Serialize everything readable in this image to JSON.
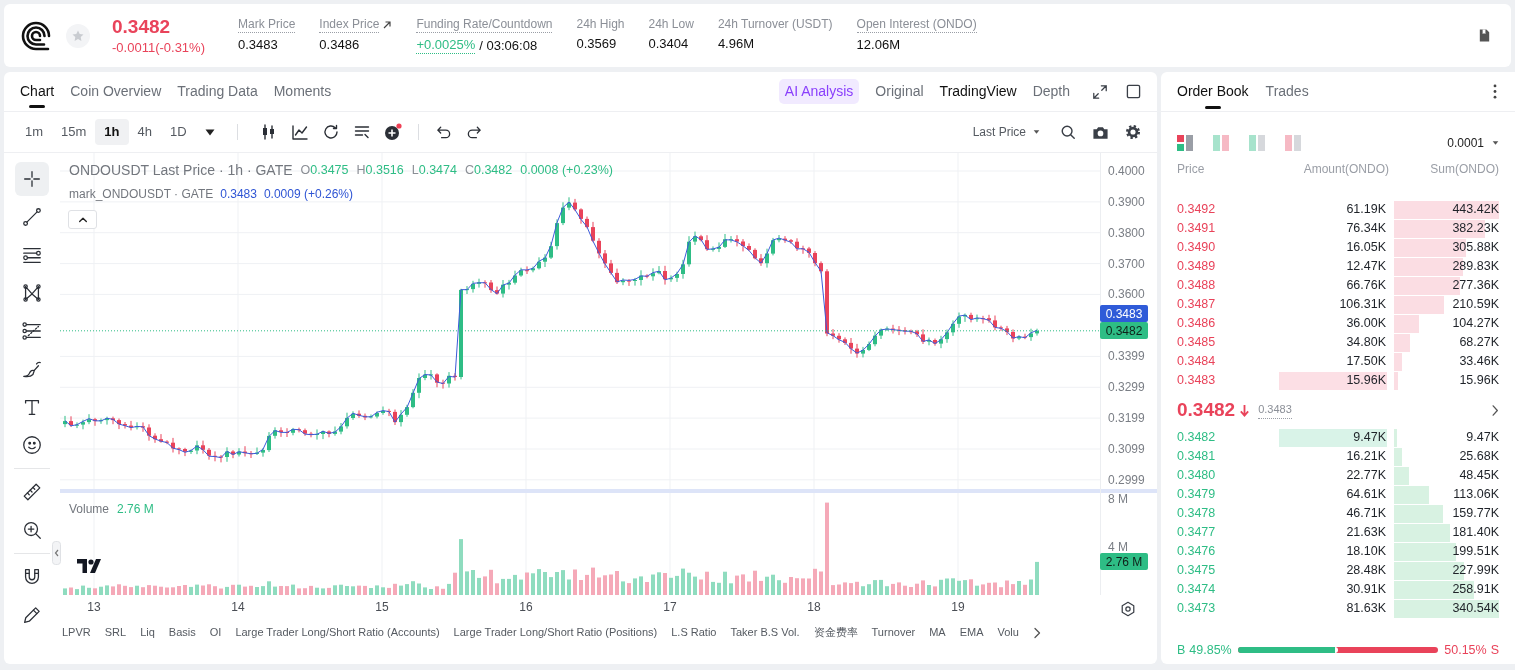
{
  "header": {
    "favorited": false,
    "price": "0.3482",
    "change": "-0.0011(-0.31%)",
    "falling": true,
    "stats": [
      {
        "kind": "plain",
        "label": "Mark Price",
        "value": "0.3483",
        "underlined": true
      },
      {
        "kind": "link",
        "label": "Index Price",
        "value": "0.3486",
        "underlined": true
      },
      {
        "kind": "funding",
        "label": "Funding Rate/Countdown",
        "value": "+0.0025%",
        "countdown": "/ 03:06:08",
        "underlined": true
      },
      {
        "kind": "plain",
        "label": "24h High",
        "value": "0.3569",
        "underlined": false
      },
      {
        "kind": "plain",
        "label": "24h Low",
        "value": "0.3404",
        "underlined": false
      },
      {
        "kind": "plain",
        "label": "24h Turnover (USDT)",
        "value": "4.96M",
        "underlined": false
      },
      {
        "kind": "plain",
        "label": "Open Interest (ONDO)",
        "value": "12.06M",
        "underlined": true
      }
    ]
  },
  "chart_panel": {
    "tabs": [
      {
        "label": "Chart",
        "selected": true
      },
      {
        "label": "Coin Overview",
        "selected": false
      },
      {
        "label": "Trading Data",
        "selected": false
      },
      {
        "label": "Moments",
        "selected": false
      }
    ],
    "views": [
      {
        "kind": "ai",
        "label": "AI Analysis",
        "selected": false
      },
      {
        "kind": "plain",
        "label": "Original",
        "selected": false
      },
      {
        "kind": "plain",
        "label": "TradingView",
        "selected": true
      },
      {
        "kind": "plain",
        "label": "Depth",
        "selected": false
      }
    ],
    "intervals": [
      {
        "label": "1m",
        "selected": false
      },
      {
        "label": "15m",
        "selected": false
      },
      {
        "label": "1h",
        "selected": true
      },
      {
        "label": "4h",
        "selected": false
      },
      {
        "label": "1D",
        "selected": false
      }
    ],
    "price_source": "Last Price",
    "tools": [
      {
        "kind": "crosshair",
        "selected": true
      },
      {
        "kind": "trend-line",
        "selected": false
      },
      {
        "kind": "parallel-lines",
        "selected": false
      },
      {
        "kind": "pattern",
        "selected": false
      },
      {
        "kind": "fib",
        "selected": false
      },
      {
        "kind": "brush",
        "selected": false
      },
      {
        "kind": "text",
        "selected": false
      },
      {
        "kind": "emoji",
        "selected": false
      },
      {
        "kind": "ruler",
        "selected": false
      },
      {
        "kind": "zoom",
        "selected": false
      },
      {
        "kind": "magnet",
        "selected": false
      },
      {
        "kind": "pencil",
        "selected": false
      }
    ],
    "chart": {
      "legend": {
        "title": "ONDOUSDT Last Price · 1h · GATE",
        "ohlc": [
          {
            "key": "O",
            "value": "0.3475"
          },
          {
            "key": "H",
            "value": "0.3516"
          },
          {
            "key": "L",
            "value": "0.3474"
          },
          {
            "key": "C",
            "value": "0.3482"
          }
        ],
        "change": "0.0008 (+0.23%)",
        "rising": true,
        "mark_title": "mark_ONDOUSDT · GATE",
        "mark_value": "0.3483",
        "mark_change": "0.0009 (+0.26%)"
      },
      "price_axis": [
        "0.4000",
        "0.3900",
        "0.3800",
        "0.3700",
        "0.3600",
        "0.3399",
        "0.3299",
        "0.3199",
        "0.3099",
        "0.2999"
      ],
      "price_tags": [
        {
          "kind": "mark",
          "label": "0.3483"
        },
        {
          "kind": "last",
          "label": "0.3482"
        }
      ],
      "volume_legend": {
        "label": "Volume",
        "value": "2.76 M"
      },
      "volume_axis": [
        "8 M",
        "4 M"
      ],
      "volume_tag": "2.76 M",
      "date_axis": [
        "13",
        "14",
        "15",
        "16",
        "17",
        "18",
        "19"
      ]
    },
    "indicators": [
      "LPVR",
      "SRL",
      "Liq",
      "Basis",
      "OI",
      "Large Trader Long/Short Ratio (Accounts)",
      "Large Trader Long/Short Ratio (Positions)",
      "L.S Ratio",
      "Taker B.S Vol.",
      "资金费率",
      "Turnover",
      "MA",
      "EMA",
      "Volu"
    ]
  },
  "order_book": {
    "tabs": [
      {
        "label": "Order Book",
        "selected": true
      },
      {
        "label": "Trades",
        "selected": false
      }
    ],
    "modes": [
      {
        "kind": "both",
        "selected": true
      },
      {
        "kind": "split",
        "selected": false
      },
      {
        "kind": "bids",
        "selected": false
      },
      {
        "kind": "asks",
        "selected": false
      }
    ],
    "precision": "0.0001",
    "columns": [
      "Price",
      "Amount(ONDO)",
      "Sum(ONDO)"
    ],
    "asks": [
      {
        "price": "0.3492",
        "amount": "61.19K",
        "sum": "443.42K",
        "highlighted": false
      },
      {
        "price": "0.3491",
        "amount": "76.34K",
        "sum": "382.23K",
        "highlighted": false
      },
      {
        "price": "0.3490",
        "amount": "16.05K",
        "sum": "305.88K",
        "highlighted": false
      },
      {
        "price": "0.3489",
        "amount": "12.47K",
        "sum": "289.83K",
        "highlighted": false
      },
      {
        "price": "0.3488",
        "amount": "66.76K",
        "sum": "277.36K",
        "highlighted": false
      },
      {
        "price": "0.3487",
        "amount": "106.31K",
        "sum": "210.59K",
        "highlighted": false
      },
      {
        "price": "0.3486",
        "amount": "36.00K",
        "sum": "104.27K",
        "highlighted": false
      },
      {
        "price": "0.3485",
        "amount": "34.80K",
        "sum": "68.27K",
        "highlighted": false
      },
      {
        "price": "0.3484",
        "amount": "17.50K",
        "sum": "33.46K",
        "highlighted": false
      },
      {
        "price": "0.3483",
        "amount": "15.96K",
        "sum": "15.96K",
        "highlighted": true
      }
    ],
    "mid": {
      "price": "0.3482",
      "falling": true,
      "mark": "0.3483"
    },
    "bids": [
      {
        "price": "0.3482",
        "amount": "9.47K",
        "sum": "9.47K",
        "highlighted": true
      },
      {
        "price": "0.3481",
        "amount": "16.21K",
        "sum": "25.68K",
        "highlighted": false
      },
      {
        "price": "0.3480",
        "amount": "22.77K",
        "sum": "48.45K",
        "highlighted": false
      },
      {
        "price": "0.3479",
        "amount": "64.61K",
        "sum": "113.06K",
        "highlighted": false
      },
      {
        "price": "0.3478",
        "amount": "46.71K",
        "sum": "159.77K",
        "highlighted": false
      },
      {
        "price": "0.3477",
        "amount": "21.63K",
        "sum": "181.40K",
        "highlighted": false
      },
      {
        "price": "0.3476",
        "amount": "18.10K",
        "sum": "199.51K",
        "highlighted": false
      },
      {
        "price": "0.3475",
        "amount": "28.48K",
        "sum": "227.99K",
        "highlighted": false
      },
      {
        "price": "0.3474",
        "amount": "30.91K",
        "sum": "258.91K",
        "highlighted": false
      },
      {
        "price": "0.3473",
        "amount": "81.63K",
        "sum": "340.54K",
        "highlighted": false
      }
    ],
    "ratio": {
      "buy_label": "B",
      "buy": "49.85%",
      "sell": "50.15%",
      "sell_label": "S",
      "level": 0.4985
    }
  }
}
